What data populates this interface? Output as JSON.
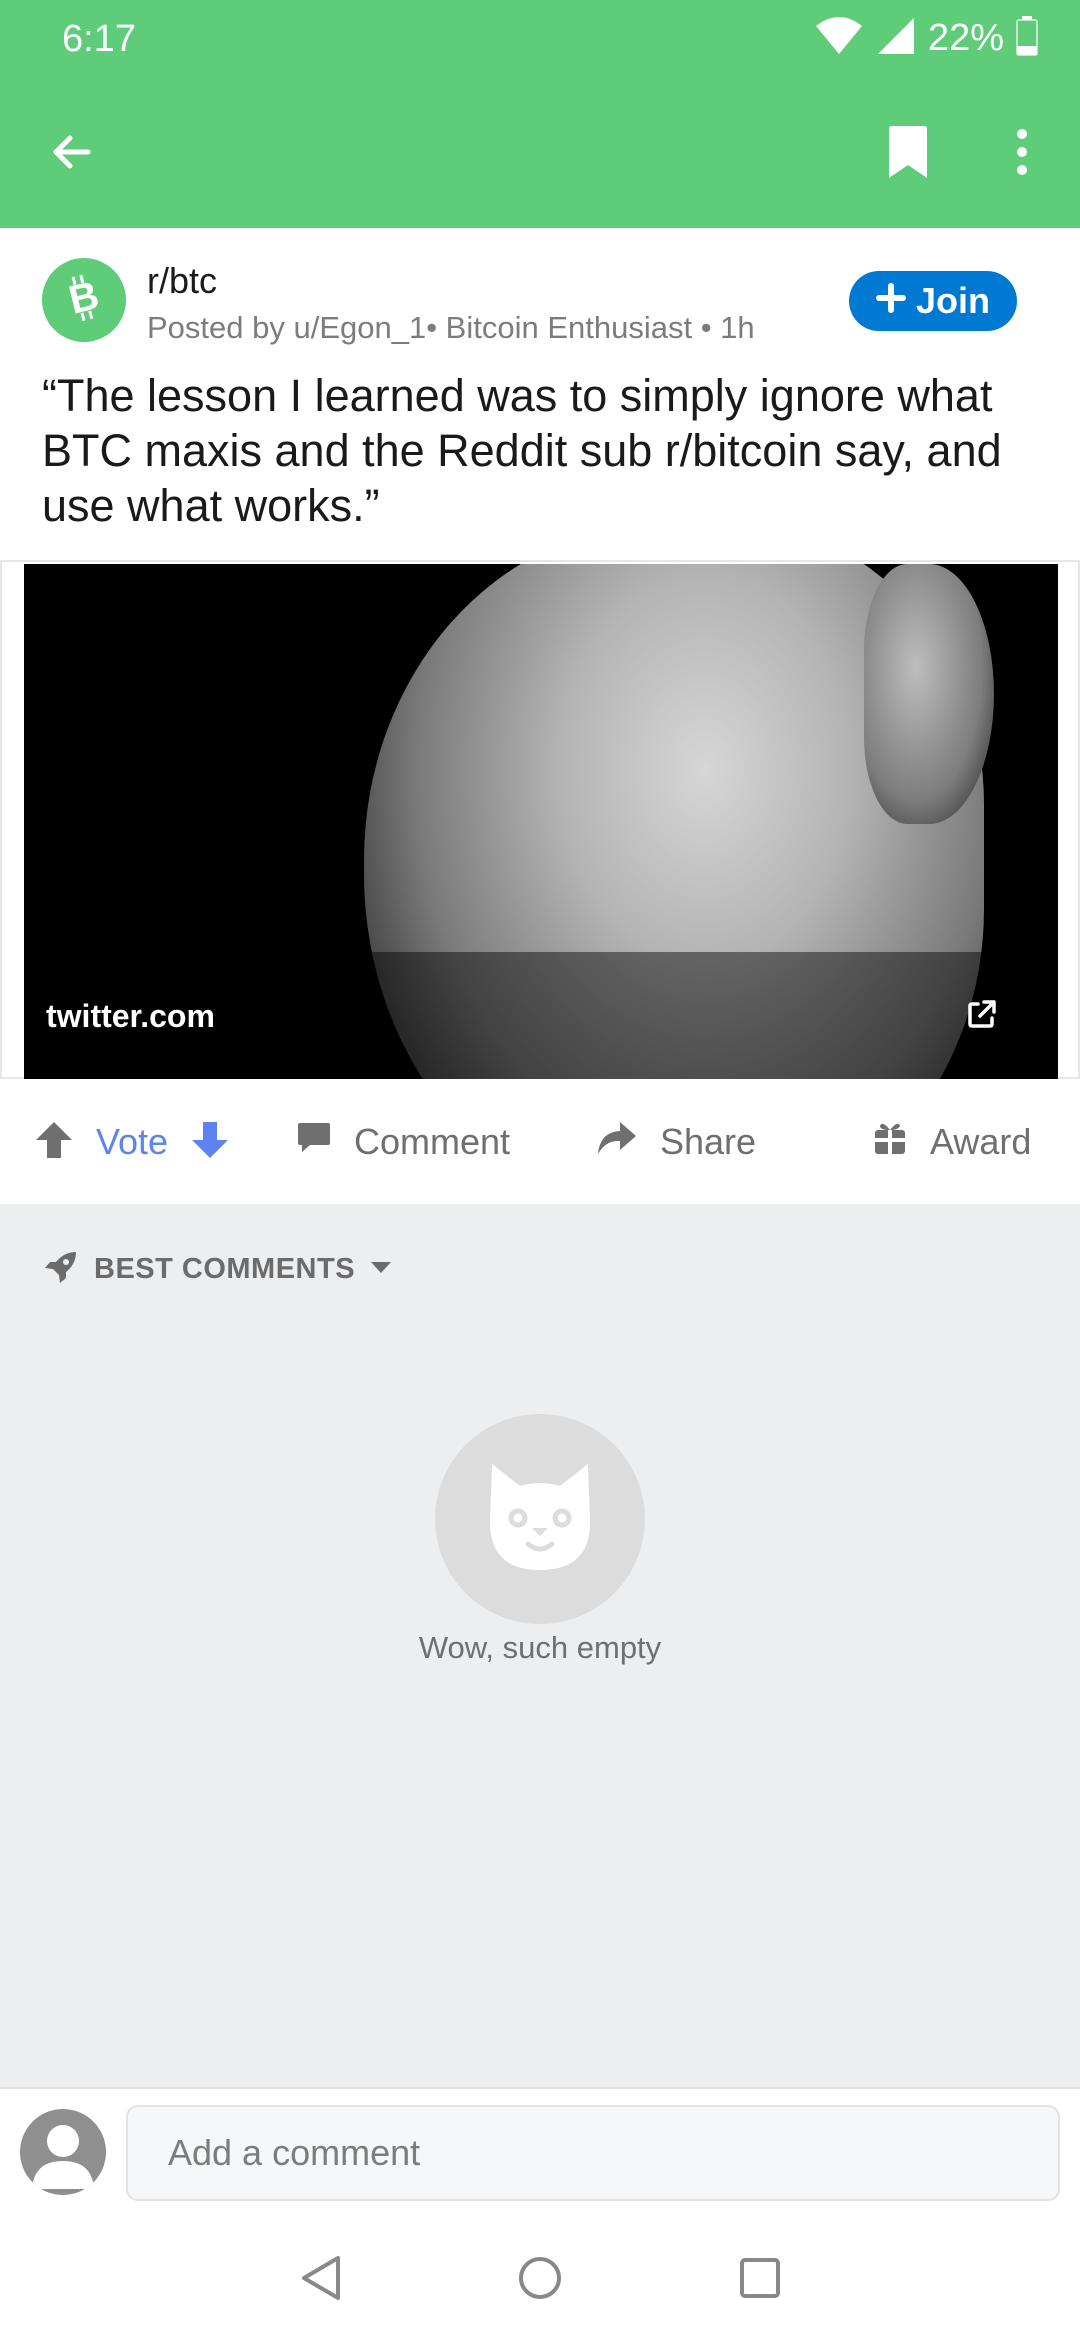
{
  "status_bar": {
    "time": "6:17",
    "battery": "22%",
    "icons": [
      "wifi-icon",
      "signal-icon",
      "battery-icon"
    ]
  },
  "app_bar": {
    "color": "#5fcc79",
    "icons": [
      "back-arrow-icon",
      "bookmark-icon",
      "more-vert-icon"
    ]
  },
  "post": {
    "subreddit": "r/btc",
    "meta": "Posted by u/Egon_1• Bitcoin Enthusiast • 1h",
    "join_label": "Join",
    "title": "“The lesson I learned was to simply ignore what BTC maxis and the Reddit sub r/bitcoin say, and use what works.”",
    "link_domain": "twitter.com"
  },
  "actions": {
    "vote_label": "Vote",
    "comment_label": "Comment",
    "share_label": "Share",
    "award_label": "Award"
  },
  "comments": {
    "sort_label": "BEST COMMENTS",
    "empty_text": "Wow, such empty",
    "input_placeholder": "Add a comment"
  },
  "colors": {
    "accent_green": "#5fcc79",
    "join_blue": "#0079d3",
    "vote_blue": "#5c83ef",
    "comments_bg": "#edeef0"
  }
}
